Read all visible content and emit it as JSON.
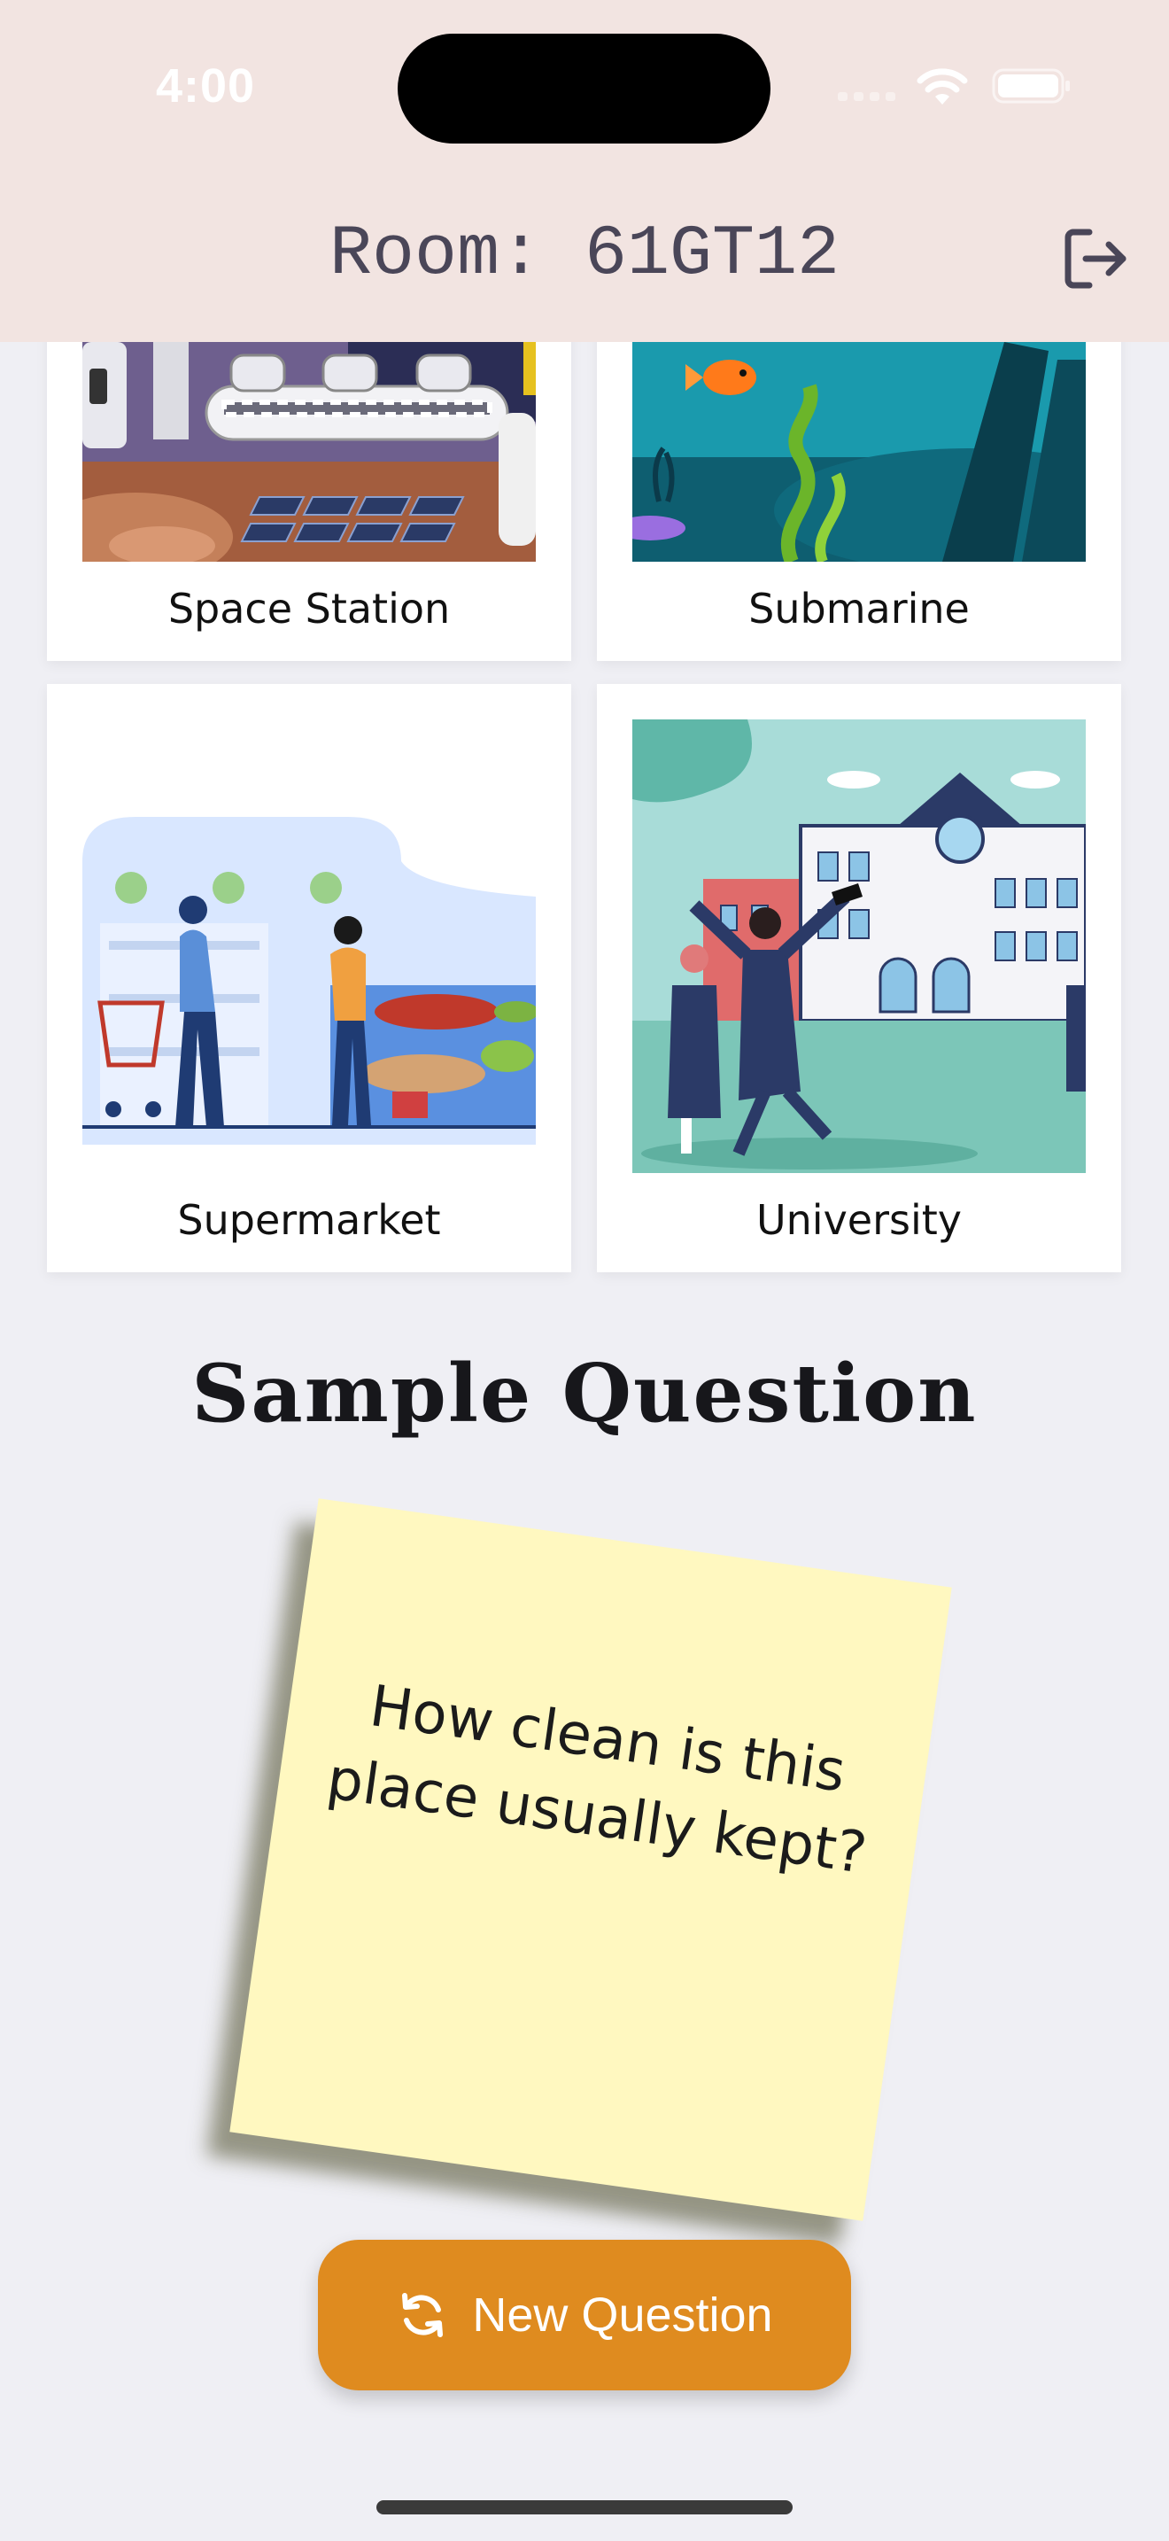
{
  "status_bar": {
    "time": "4:00"
  },
  "header": {
    "room_title": "Room: 61GT12"
  },
  "cards": [
    {
      "label": "Space Station",
      "icon": "space-station-illustration"
    },
    {
      "label": "Submarine",
      "icon": "submarine-illustration"
    },
    {
      "label": "Supermarket",
      "icon": "supermarket-illustration"
    },
    {
      "label": "University",
      "icon": "university-illustration"
    }
  ],
  "sample": {
    "title": "Sample Question",
    "question": "How clean is this place usually kept?"
  },
  "button": {
    "label": "New Question",
    "icon": "refresh-icon"
  },
  "colors": {
    "header_bg": "#f2e4e1",
    "page_bg": "#efeff4",
    "note_bg": "#fff8c0",
    "button_bg": "#df8b1f"
  }
}
